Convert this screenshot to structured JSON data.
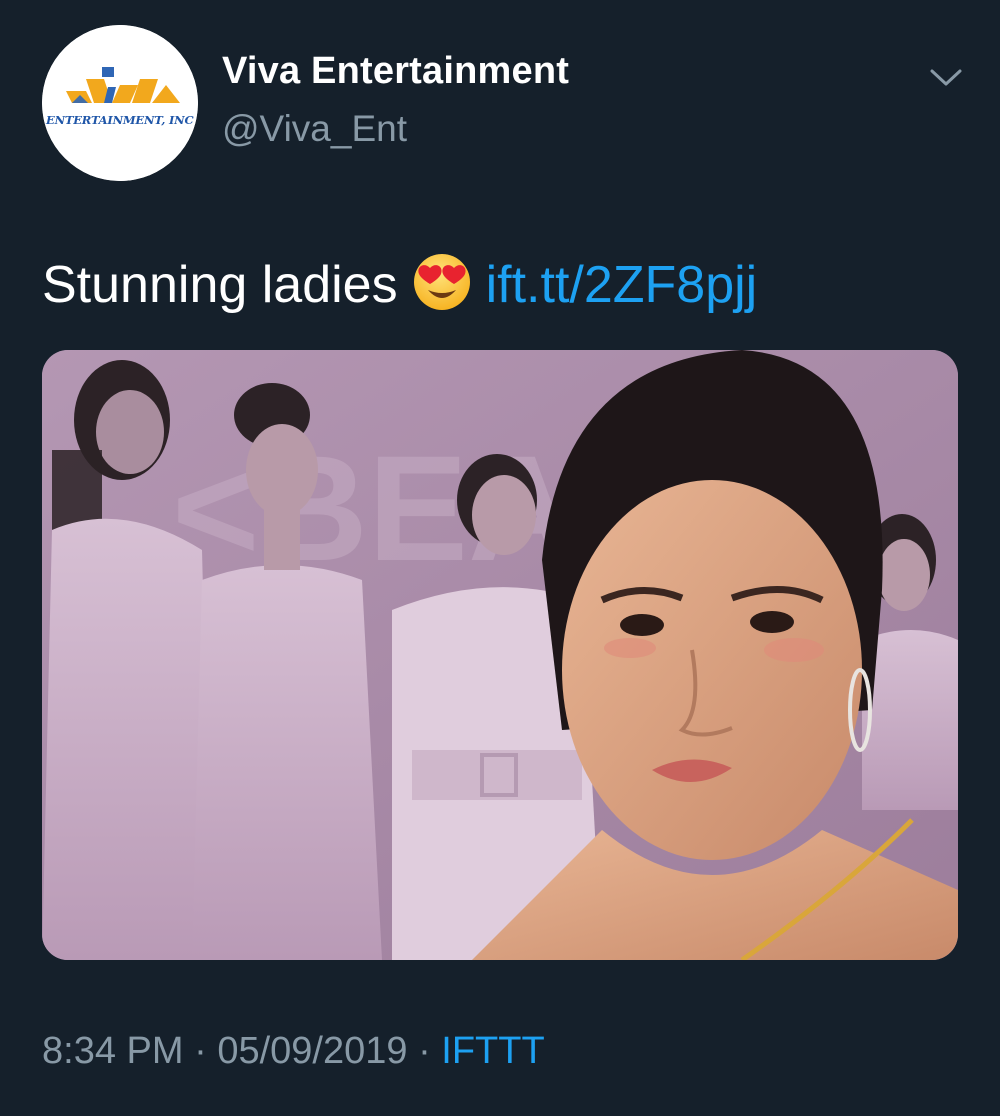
{
  "account": {
    "display_name": "Viva Entertainment",
    "handle": "@Viva_Ent",
    "avatar_text": "ENTERTAINMENT, INC"
  },
  "tweet": {
    "text": "Stunning ladies",
    "emoji": "heart-eyes-emoji",
    "link": "ift.tt/2ZF8pjj"
  },
  "meta": {
    "time": "8:34 PM",
    "separator": "·",
    "date": "05/09/2019",
    "source": "IFTTT"
  },
  "colors": {
    "background": "#15202b",
    "link": "#1da1f2",
    "secondary_text": "#8899a6"
  }
}
